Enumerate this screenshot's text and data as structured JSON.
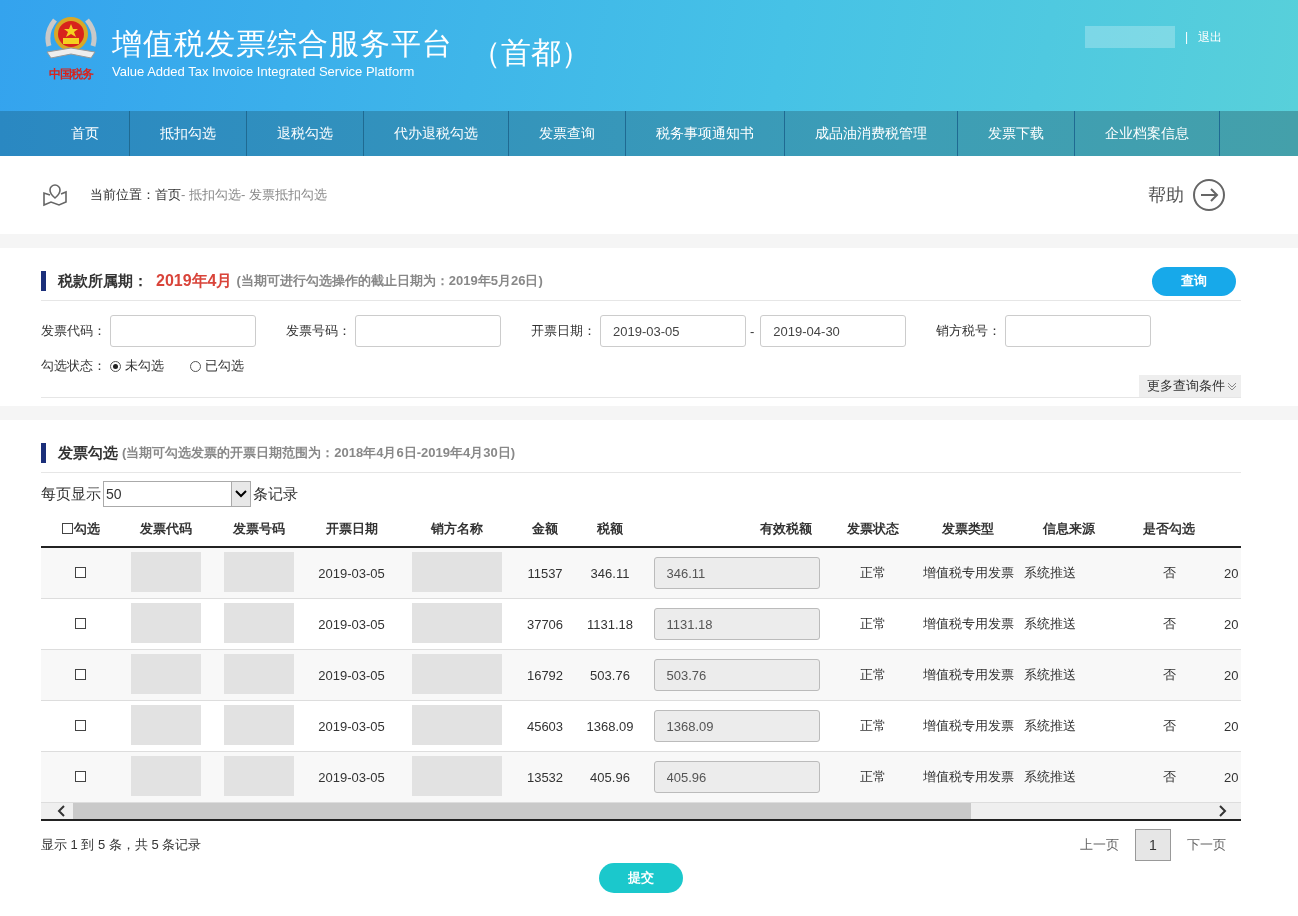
{
  "header": {
    "logo_caption": "中国税务",
    "title": "增值税发票综合服务平台",
    "subtitle": "Value Added Tax Invoice Integrated Service Platform",
    "region": "（首都）",
    "separator": "|",
    "logout": "退出"
  },
  "nav": [
    {
      "label": "首页",
      "selected": false
    },
    {
      "label": "抵扣勾选",
      "selected": false
    },
    {
      "label": "退税勾选",
      "selected": false
    },
    {
      "label": "代办退税勾选",
      "selected": false
    },
    {
      "label": "发票查询",
      "selected": false
    },
    {
      "label": "税务事项通知书",
      "selected": false
    },
    {
      "label": "成品油消费税管理",
      "selected": false
    },
    {
      "label": "发票下载",
      "selected": false
    },
    {
      "label": "企业档案信息",
      "selected": false
    }
  ],
  "breadcrumb": {
    "label": "当前位置：",
    "items": [
      "首页",
      "抵扣勾选",
      "发票抵扣勾选"
    ],
    "separator": "-",
    "help": "帮助"
  },
  "query": {
    "title": "税款所属期：",
    "period": "2019年4月",
    "note": "(当期可进行勾选操作的截止日期为：2019年5月26日)",
    "search_button": "查询",
    "fields": [
      {
        "label": "发票代码："
      },
      {
        "label": "发票号码："
      },
      {
        "label": "开票日期：",
        "value": "2019-03-05",
        "range_separator": "-",
        "value_to": "2019-04-30"
      },
      {
        "label": "销方税号："
      }
    ],
    "status_label": "勾选状态：",
    "status_options": [
      {
        "label": "未勾选",
        "selected": true
      },
      {
        "label": "已勾选",
        "selected": false
      }
    ],
    "more": "更多查询条件"
  },
  "table_section": {
    "title": "发票勾选",
    "note": "(当期可勾选发票的开票日期范围为：2018年4月6日-2019年4月30日)",
    "page_size_label": "每页显示",
    "page_size": "50",
    "page_size_suffix": "条记录",
    "columns": [
      "勾选",
      "发票代码",
      "发票号码",
      "开票日期",
      "销方名称",
      "金额",
      "税额",
      "有效税额",
      "发票状态",
      "发票类型",
      "信息来源",
      "是否勾选"
    ],
    "header_checked": false,
    "rows": [
      {
        "checked": false,
        "date": "2019-03-05",
        "amount": "11537",
        "tax": "346.11",
        "effective_tax": "346.11",
        "status": "正常",
        "type": "增值税专用发票",
        "source": "系统推送",
        "selected_flag": "否",
        "column_13": "20"
      },
      {
        "checked": false,
        "date": "2019-03-05",
        "amount": "37706",
        "tax": "1131.18",
        "effective_tax": "1131.18",
        "status": "正常",
        "type": "增值税专用发票",
        "source": "系统推送",
        "selected_flag": "否",
        "column_13": "20"
      },
      {
        "checked": false,
        "date": "2019-03-05",
        "amount": "16792",
        "tax": "503.76",
        "effective_tax": "503.76",
        "status": "正常",
        "type": "增值税专用发票",
        "source": "系统推送",
        "selected_flag": "否",
        "column_13": "20"
      },
      {
        "checked": false,
        "date": "2019-03-05",
        "amount": "45603",
        "tax": "1368.09",
        "effective_tax": "1368.09",
        "status": "正常",
        "type": "增值税专用发票",
        "source": "系统推送",
        "selected_flag": "否",
        "column_13": "20"
      },
      {
        "checked": false,
        "date": "2019-03-05",
        "amount": "13532",
        "tax": "405.96",
        "effective_tax": "405.96",
        "status": "正常",
        "type": "增值税专用发票",
        "source": "系统推送",
        "selected_flag": "否",
        "column_13": "20"
      }
    ],
    "summary": "显示 1 到 5 条，共 5 条记录",
    "pagination": {
      "prev": "上一页",
      "pages": [
        {
          "label": "1",
          "selected": true
        }
      ],
      "next": "下一页"
    },
    "submit": "提交"
  }
}
